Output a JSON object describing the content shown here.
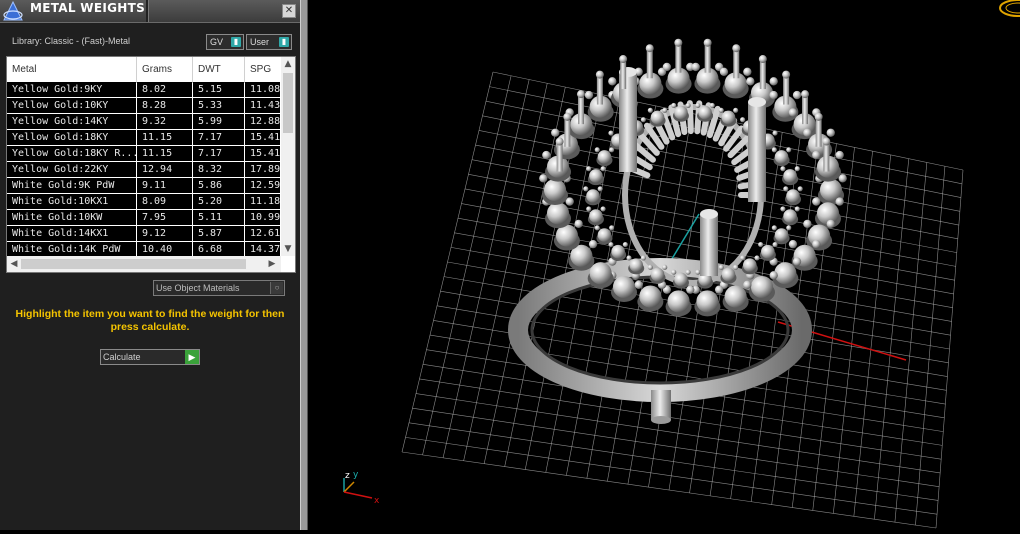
{
  "panel": {
    "title": "METAL WEIGHTS",
    "close_label": "✕",
    "library_label": "Library: Classic - (Fast)-Metal",
    "dropdown_gv": "GV",
    "dropdown_user": "User",
    "columns": [
      "Metal",
      "Grams",
      "DWT",
      "SPG"
    ],
    "rows": [
      [
        "Yellow Gold:9KY",
        "8.02",
        "5.15",
        "11.08"
      ],
      [
        "Yellow Gold:10KY",
        "8.28",
        "5.33",
        "11.43"
      ],
      [
        "Yellow Gold:14KY",
        "9.32",
        "5.99",
        "12.88"
      ],
      [
        "Yellow Gold:18KY",
        "11.15",
        "7.17",
        "15.41"
      ],
      [
        "Yellow Gold:18KY R...",
        "11.15",
        "7.17",
        "15.41"
      ],
      [
        "Yellow Gold:22KY",
        "12.94",
        "8.32",
        "17.89"
      ],
      [
        "White Gold:9K PdW",
        "9.11",
        "5.86",
        "12.59"
      ],
      [
        "White Gold:10KX1",
        "8.09",
        "5.20",
        "11.18"
      ],
      [
        "White Gold:10KW",
        "7.95",
        "5.11",
        "10.99"
      ],
      [
        "White Gold:14KX1",
        "9.12",
        "5.87",
        "12.61"
      ],
      [
        "White Gold:14K PdW",
        "10.40",
        "6.68",
        "14.37"
      ]
    ],
    "use_object_materials": "Use Object Materials",
    "hint": "Highlight the item you want to find the weight for then press calculate.",
    "calculate_label": "Calculate"
  },
  "viewport": {
    "axis_labels": [
      "z",
      "y",
      "x"
    ],
    "colors": {
      "x_axis": "#d01010",
      "y_axis": "#1aa0a0",
      "grid": "#b8b8b8",
      "model": "#c8c8c8"
    }
  }
}
